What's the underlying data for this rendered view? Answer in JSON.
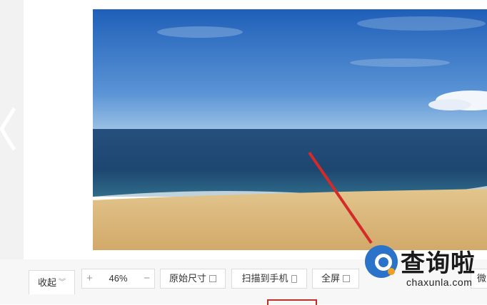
{
  "toolbar": {
    "collapse_label": "收起",
    "collapse_chevron": "︾",
    "zoom_plus": "+",
    "zoom_value": "46%",
    "zoom_minus": "−",
    "original_size_label": "原始尺寸",
    "scan_to_phone_label": "扫描到手机",
    "fullscreen_label": "全屏",
    "more_label": "微"
  },
  "watermark": {
    "cn_text": "查询啦",
    "en_text": "chaxunla.com"
  },
  "colors": {
    "annotation_red": "#d42a2a",
    "brand_blue": "#2a73c9",
    "brand_orange": "#f0a020"
  },
  "icons": [
    "left-arrow-icon",
    "chevron-down-icon",
    "original-size-icon",
    "phone-icon",
    "fullscreen-icon"
  ]
}
